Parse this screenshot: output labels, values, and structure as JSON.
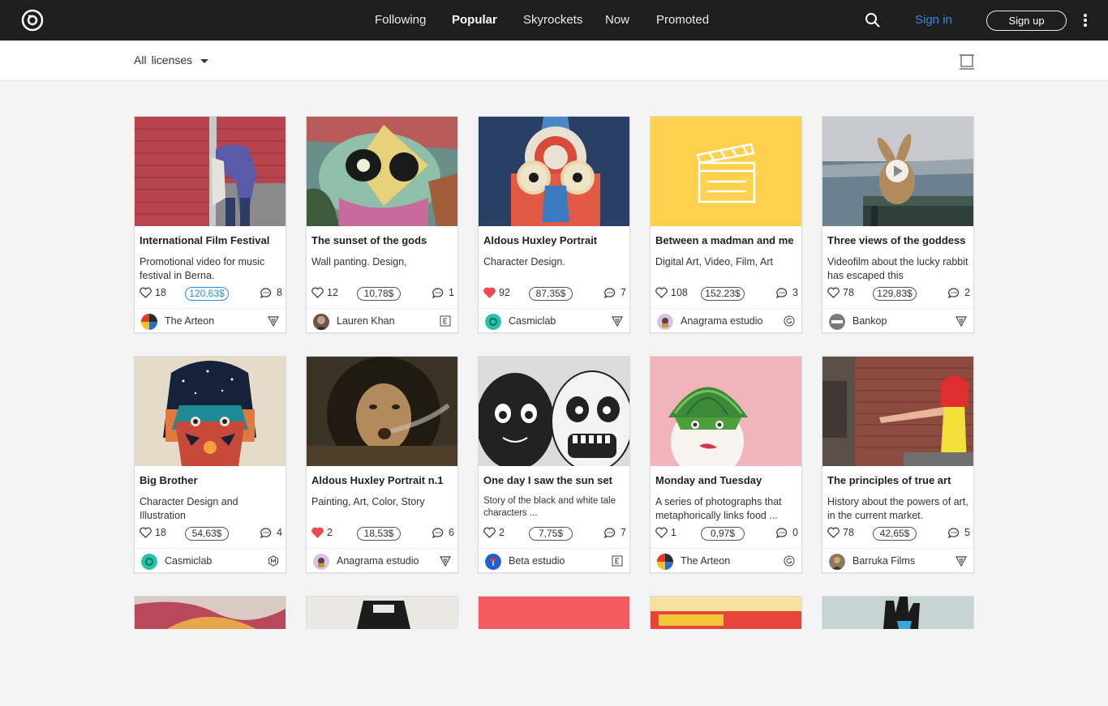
{
  "nav": {
    "items": [
      {
        "label": "Following",
        "active": false
      },
      {
        "label": "Popular",
        "active": true
      },
      {
        "label": "Skyrockets",
        "active": false
      },
      {
        "label": "Now",
        "active": false
      },
      {
        "label": "Promoted",
        "active": false
      }
    ],
    "signin_label": "Sign in",
    "signup_label": "Sign up"
  },
  "filter": {
    "all_label": "All",
    "licenses_label": "licenses"
  },
  "colors": {
    "accent": "#2b8dee",
    "topbar": "#1e1e1e",
    "heart_active": "#f0484f"
  },
  "cards": [
    {
      "title": "International Film Festival",
      "desc": "Promotional video for music festival in Berna.",
      "likes": "18",
      "liked": false,
      "price": "120,63$",
      "price_highlight": true,
      "comments": "8",
      "author": "The Arteon",
      "license_icon": "triangle-icon"
    },
    {
      "title": "The sunset of the gods",
      "desc": "Wall panting.  Design,",
      "likes": "12",
      "liked": false,
      "price": "10,78$",
      "price_highlight": false,
      "comments": "1",
      "author": "Lauren Khan",
      "license_icon": "e-square-icon"
    },
    {
      "title": "Aldous Huxley Portrait",
      "desc": "Character Design.",
      "likes": "92",
      "liked": true,
      "price": "87,35$",
      "price_highlight": false,
      "comments": "7",
      "author": "Casmiclab",
      "license_icon": "triangle-icon"
    },
    {
      "title": "Between a madman and me",
      "desc": "Digital Art, Video, Film, Art",
      "likes": "108",
      "liked": false,
      "price": "152,23$",
      "price_highlight": false,
      "comments": "3",
      "author": "Anagrama estudio",
      "license_icon": "g-circle-icon"
    },
    {
      "title": "Three views of the goddess",
      "desc": "Videofilm about the lucky rabbit has escaped this",
      "likes": "78",
      "liked": false,
      "price": "129,83$",
      "price_highlight": false,
      "comments": "2",
      "author": "Bankop",
      "license_icon": "triangle-icon"
    },
    {
      "title": "Big Brother",
      "desc": "Character Design and Illustration",
      "likes": "18",
      "liked": false,
      "price": "54,63$",
      "price_highlight": false,
      "comments": "4",
      "author": "Casmiclab",
      "license_icon": "m-hexagon-icon"
    },
    {
      "title": "Aldous Huxley Portrait n.1",
      "desc": "Painting, Art, Color, Story",
      "likes": "2",
      "liked": true,
      "price": "18,53$",
      "price_highlight": false,
      "comments": "6",
      "author": "Anagrama estudio",
      "license_icon": "triangle-icon"
    },
    {
      "title": "One day I saw the sun set",
      "desc": "Story of the black and white tale characters ...",
      "desc_small": true,
      "likes": "2",
      "liked": false,
      "price": "7,75$",
      "price_highlight": false,
      "comments": "7",
      "author": "Beta estudio",
      "license_icon": "e-square-icon"
    },
    {
      "title": "Monday and Tuesday",
      "desc": "A series of photographs that metaphorically links food ...",
      "likes": "1",
      "liked": false,
      "price": "0,97$",
      "price_highlight": false,
      "comments": "0",
      "author": "The Arteon",
      "license_icon": "g-circle-icon"
    },
    {
      "title": "The principles of true art",
      "desc": "History about the powers of art, in the current market.",
      "likes": "78",
      "liked": false,
      "price": "42,65$",
      "price_highlight": false,
      "comments": "5",
      "author": "Barruka Films",
      "license_icon": "triangle-icon"
    }
  ]
}
